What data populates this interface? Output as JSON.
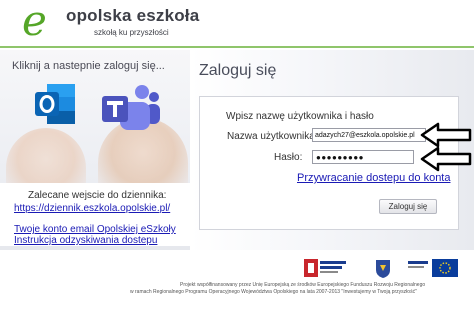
{
  "header": {
    "logo_letter": "e",
    "logo_title": "opolska eszkoła",
    "logo_subtitle": "szkołą ku przyszłości"
  },
  "left": {
    "hint": "Kliknij a nastepnie zaloguj się...",
    "apps": [
      {
        "name": "Outlook",
        "icon": "outlook-icon",
        "color": "#0a64b4"
      },
      {
        "name": "Teams",
        "icon": "teams-icon",
        "color": "#5558af"
      }
    ],
    "recommended_text": "Zalecane wejscie do dziennika:",
    "recommended_link": "https://dziennik.eszkola.opolskie.pl/",
    "account_link": "Twoje konto email Opolskiej eSzkoły",
    "recovery_link": "Instrukcja odzyskiwania dostepu"
  },
  "login": {
    "title": "Zaloguj się",
    "subtitle": "Wpisz nazwę użytkownika i hasło",
    "username_label": "Nazwa użytkownika:",
    "username_value": "adazych27@eszkola.opolskie.pl",
    "password_label": "Hasło:",
    "password_value": "●●●●●●●●●",
    "forgot_link": "Przywracanie dostepu do konta",
    "submit_label": "Zaloguj się"
  },
  "footer": {
    "line1": "Projekt współfinansowany przez Unię Europejską ze środków Europejskiego Funduszu Rozwoju Regionalnego",
    "line2": "w ramach Regionalnego Programu Operacyjnego Województwa Opolskiego na lata 2007-2013 \"Inwestujemy w Twoją przyszłość\"",
    "logos": [
      "program-regionalny-logo",
      "opolskie-coat-of-arms",
      "eu-flag"
    ]
  },
  "colors": {
    "brand_green": "#55a628",
    "link_blue": "#1a1ab5"
  }
}
